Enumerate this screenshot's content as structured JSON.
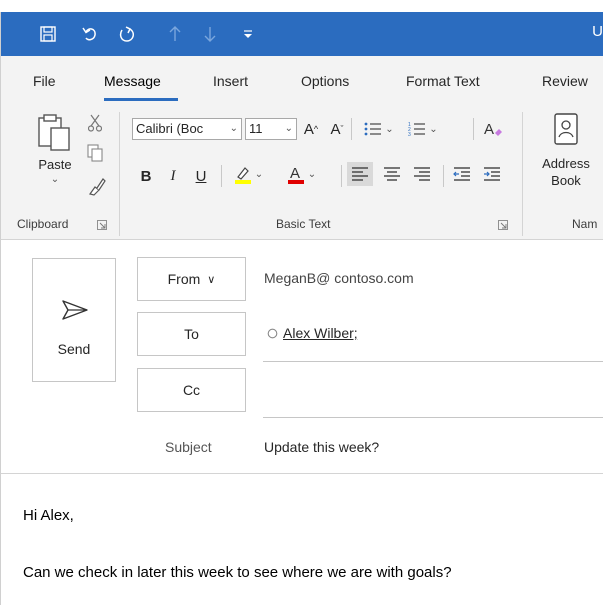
{
  "title_bar": {
    "save_icon": "save-icon",
    "undo_icon": "undo-icon",
    "redo_icon": "redo-icon",
    "up_icon": "arrow-up-icon",
    "down_icon": "arrow-down-icon",
    "customize_icon": "customize-qat-icon",
    "title_fragment": "U",
    "accent_color": "#2b6cbf"
  },
  "tabs": [
    "File",
    "Message",
    "Insert",
    "Options",
    "Format Text",
    "Review"
  ],
  "active_tab": "Message",
  "ribbon": {
    "clipboard": {
      "paste_label": "Paste",
      "group_label": "Clipboard"
    },
    "basic_text": {
      "font_name": "Calibri (Boc",
      "font_size": "11",
      "group_label": "Basic Text",
      "bold": "B",
      "italic": "I",
      "underline": "U",
      "highlight_color": "#ffff00",
      "font_color": "#e00000"
    },
    "names": {
      "address_book_line1": "Address",
      "address_book_line2": "Book",
      "group_label": "Nam"
    }
  },
  "compose": {
    "send_label": "Send",
    "from_label": "From",
    "to_label": "To",
    "cc_label": "Cc",
    "subject_label": "Subject",
    "from_value": "MeganB@ contoso.com",
    "to_value": "Alex Wilber;",
    "cc_value": "",
    "subject_value": "Update this week?"
  },
  "body": {
    "greeting": "Hi Alex,",
    "line1": "Can we check in later this week to see where we are with goals?"
  }
}
